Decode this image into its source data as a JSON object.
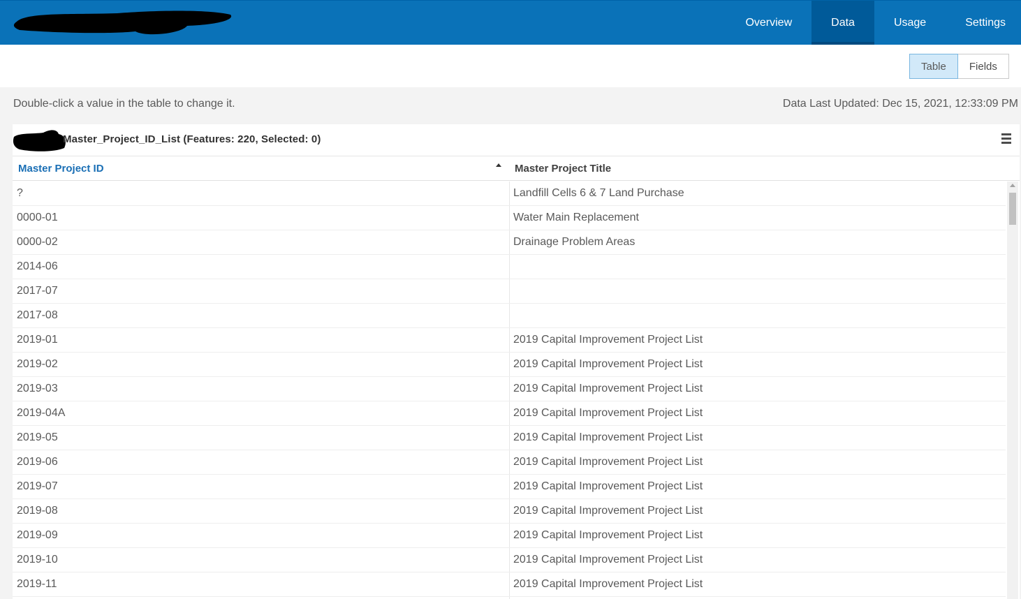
{
  "nav": {
    "items": [
      {
        "label": "Overview",
        "active": false
      },
      {
        "label": "Data",
        "active": true
      },
      {
        "label": "Usage",
        "active": false
      },
      {
        "label": "Settings",
        "active": false
      }
    ]
  },
  "view_toggle": {
    "table_label": "Table",
    "fields_label": "Fields",
    "selected": "Table"
  },
  "info": {
    "hint": "Double-click a value in the table to change it.",
    "last_updated": "Data Last Updated: Dec 15, 2021, 12:33:09 PM"
  },
  "layer": {
    "title": "Master_Project_ID_List (Features: 220, Selected: 0)"
  },
  "table": {
    "columns": [
      {
        "label": "Master Project ID",
        "sorted": "ascending"
      },
      {
        "label": "Master Project Title"
      }
    ],
    "rows": [
      {
        "id": "?",
        "title": "Landfill Cells 6 & 7 Land Purchase"
      },
      {
        "id": "0000-01",
        "title": "Water Main Replacement"
      },
      {
        "id": "0000-02",
        "title": "Drainage Problem Areas"
      },
      {
        "id": "2014-06",
        "title": ""
      },
      {
        "id": "2017-07",
        "title": ""
      },
      {
        "id": "2017-08",
        "title": ""
      },
      {
        "id": "2019-01",
        "title": "2019 Capital Improvement Project List"
      },
      {
        "id": "2019-02",
        "title": "2019 Capital Improvement Project List"
      },
      {
        "id": "2019-03",
        "title": "2019 Capital Improvement Project List"
      },
      {
        "id": "2019-04A",
        "title": "2019 Capital Improvement Project List"
      },
      {
        "id": "2019-05",
        "title": "2019 Capital Improvement Project List"
      },
      {
        "id": "2019-06",
        "title": "2019 Capital Improvement Project List"
      },
      {
        "id": "2019-07",
        "title": "2019 Capital Improvement Project List"
      },
      {
        "id": "2019-08",
        "title": "2019 Capital Improvement Project List"
      },
      {
        "id": "2019-09",
        "title": "2019 Capital Improvement Project List"
      },
      {
        "id": "2019-10",
        "title": "2019 Capital Improvement Project List"
      },
      {
        "id": "2019-11",
        "title": "2019 Capital Improvement Project List"
      },
      {
        "id": "",
        "title": ""
      }
    ]
  },
  "icons": {
    "menu": "hamburger-menu-icon",
    "sort": "sort-ascending-icon"
  },
  "colors": {
    "nav_bg": "#0a72b8",
    "nav_active": "#005a99",
    "link_blue": "#1a6fb5",
    "toggle_on": "#d2e9f9"
  }
}
